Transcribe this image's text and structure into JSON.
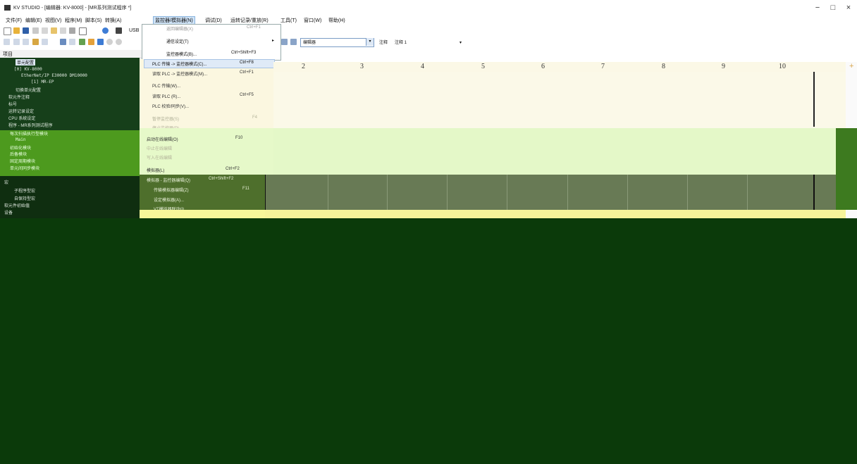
{
  "window": {
    "title": "KV STUDIO - [编辑器: KV-8000] - [MR系列测试程序 *]",
    "minimize": "−",
    "maximize": "□",
    "close": "×"
  },
  "menubar": {
    "items": [
      {
        "label": "文件(F)"
      },
      {
        "label": "编辑(E)"
      },
      {
        "label": "视图(V)"
      },
      {
        "label": "程序(M)"
      },
      {
        "label": "脚本(S)"
      },
      {
        "label": "转换(A)"
      },
      {
        "label": "监控器/模拟器(N)"
      },
      {
        "label": "调试(D)"
      },
      {
        "label": "运转记录/重放(R)"
      },
      {
        "label": "工具(T)"
      },
      {
        "label": "窗口(W)"
      },
      {
        "label": "帮助(H)"
      }
    ]
  },
  "toolbar": {
    "usb_label": "USB",
    "editor_select_value": "编辑器",
    "comment_label": "注释",
    "comment1_label": "注释 1"
  },
  "project": {
    "title": "项目",
    "tree_top": [
      "单元配置",
      "[0] KV-8000",
      "EtherNet/IP  E30000  DM10000",
      "[1] MR-EP",
      "切换单元配置",
      "软元件注释",
      "标号",
      "运转记录设定",
      "CPU 系统设定",
      "程序 - MR系列测试程序"
    ],
    "tree_mid": [
      "每次扫描执行型模块",
      "Main",
      "初始化模块",
      "后备模块",
      "固定周期模块",
      "单元间同步模块"
    ],
    "tree_bot": [
      "宏",
      "子程序型宏",
      "自保持型宏",
      "软元件初始值",
      "设备"
    ]
  },
  "menu_monitor": {
    "items": [
      {
        "label": "返回编辑器(X)",
        "shortcut": "Ctrl+F1"
      },
      {
        "label": "通信设定(T)",
        "shortcut": "▸"
      },
      {
        "label": "监控器模式(B)...",
        "shortcut": "Ctrl+Shift+F3"
      },
      {
        "label": "PLC 传输 -> 监控器模式(C)...",
        "shortcut": "Ctrl+F8"
      }
    ]
  },
  "submenu": {
    "items": [
      {
        "label": "读取 PLC -> 监控器模式(M)...",
        "shortcut": "Ctrl+F1"
      },
      {
        "label": "PLC 传输(W)...",
        "shortcut": ""
      },
      {
        "label": "读取 PLC (R)...",
        "shortcut": "Ctrl+F5"
      },
      {
        "label": "PLC 校验/同步(V)...",
        "shortcut": ""
      },
      {
        "label": "暂停监控器(S)",
        "shortcut": "F4"
      },
      {
        "label": "停止监控器(P)...",
        "shortcut": ""
      },
      {
        "label": "启动在线编辑(O)",
        "shortcut": "F10"
      },
      {
        "label": "中止在线编辑",
        "shortcut": ""
      },
      {
        "label": "写入在线编辑",
        "shortcut": ""
      },
      {
        "label": "模拟器(L)",
        "shortcut": "Ctrl+F2"
      },
      {
        "label": "模拟器 - 监控器编辑(Q)",
        "shortcut": "Ctrl+Shift+F2"
      },
      {
        "label": "传输模拟器编辑(Z)",
        "shortcut": "F11"
      },
      {
        "label": "设定模拟器(A)...",
        "shortcut": ""
      },
      {
        "label": "VT模拟器联动(I)...",
        "shortcut": ""
      }
    ]
  },
  "ladder": {
    "columns": [
      "2",
      "3",
      "4",
      "5",
      "6",
      "7",
      "8",
      "9",
      "10"
    ]
  },
  "colors": {
    "dark_green": "#0b3a0a",
    "light_green": "#e4f8c8",
    "cream": "#fbf9e8",
    "yellow": "#f6f49a",
    "olive": "#687a55",
    "highlight": "#dfeaf7"
  }
}
